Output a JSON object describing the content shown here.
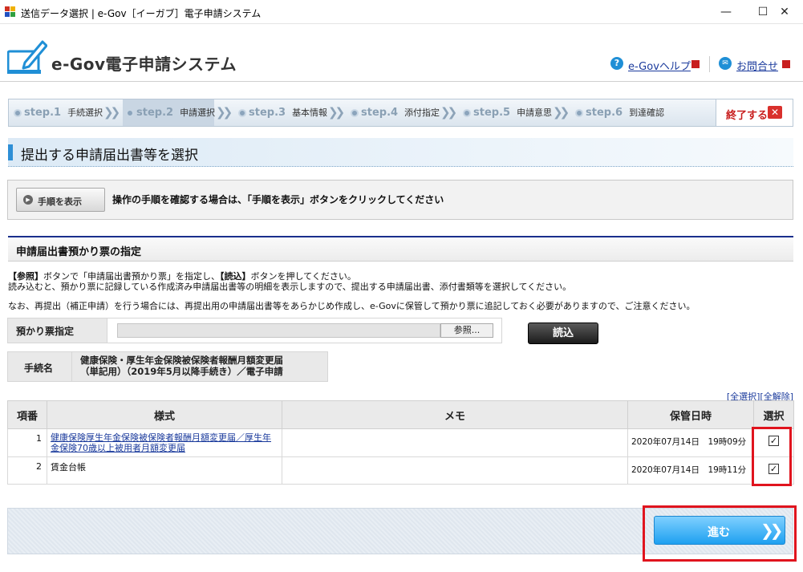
{
  "window": {
    "title": "送信データ選択 | e-Gov［イーガブ］電子申請システム",
    "minimize": "—",
    "maximize": "☐",
    "close": "✕"
  },
  "header": {
    "logo_text": "e-Gov電子申請システム",
    "help_label": "e-Govヘルプ",
    "contact_label": "お問合せ"
  },
  "steps": [
    {
      "num": "step.1",
      "label": "手続選択"
    },
    {
      "num": "step.2",
      "label": "申請選択"
    },
    {
      "num": "step.3",
      "label": "基本情報"
    },
    {
      "num": "step.4",
      "label": "添付指定"
    },
    {
      "num": "step.5",
      "label": "申請意思"
    },
    {
      "num": "step.6",
      "label": "到達確認"
    }
  ],
  "end_label": "終了する",
  "page_title": "提出する申請届出書等を選択",
  "help": {
    "button_label": "手順を表示",
    "text": "操作の手順を確認する場合は、「手順を表示」ボタンをクリックしてください"
  },
  "section": {
    "title": "申請届出書預かり票の指定",
    "line1_ref": "【参照】",
    "line1_mid": "ボタンで「申請届出書預かり票」を指定し、",
    "line1_read": "【読込】",
    "line1_end": "ボタンを押してください。",
    "line2": "読み込むと、預かり票に記録している作成済み申請届出書等の明細を表示しますので、提出する申請届出書、添付書類等を選択してください。",
    "line3": "なお、再提出（補正申請）を行う場合には、再提出用の申請届出書等をあらかじめ作成し、e-Govに保管して預かり票に追記しておく必要がありますので、ご注意ください。"
  },
  "form": {
    "voucher_label": "預かり票指定",
    "browse_label": "参照...",
    "read_label": "読込",
    "procedure_label": "手続名",
    "procedure_line1": "健康保険・厚生年金保険被保険者報酬月額変更届",
    "procedure_line2": "（単記用）（2019年5月以降手続き）／電子申請"
  },
  "select_links": {
    "all": "全選択",
    "clear": "全解除"
  },
  "table": {
    "headers": [
      "項番",
      "様式",
      "メモ",
      "保管日時",
      "選択"
    ],
    "rows": [
      {
        "no": "1",
        "name": "健康保険厚生年金保険被保険者報酬月額変更届／厚生年金保険70歳以上被用者月額変更届",
        "memo": "",
        "date": "2020年07月14日　19時09分",
        "checked": "✓"
      },
      {
        "no": "2",
        "name": "賃金台帳",
        "memo": "",
        "date": "2020年07月14日　19時11分",
        "checked": "✓"
      }
    ]
  },
  "next_label": "進む",
  "colors": {
    "accent": "#1ea0f0",
    "highlight": "#e0141e",
    "link": "#1a3a9c",
    "navy": "#1a2f8c"
  }
}
